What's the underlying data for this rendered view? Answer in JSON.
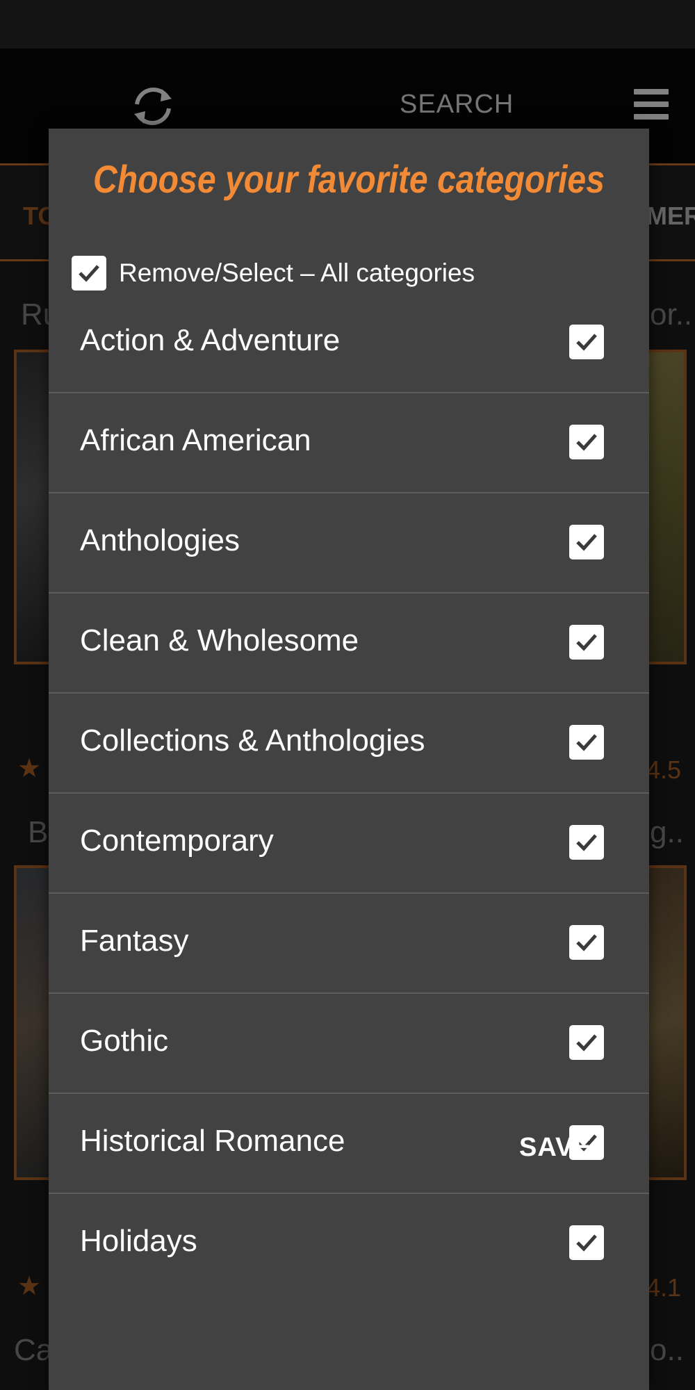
{
  "header": {
    "search_label": "SEARCH",
    "refresh_icon": "refresh-icon",
    "menu_icon": "hamburger-menu-icon"
  },
  "tabs": {
    "left_partial": "TO",
    "right_partial": "MER"
  },
  "background": {
    "items": [
      {
        "title_left": "Ru",
        "title_right": "or..",
        "rating": "4.5"
      },
      {
        "title_left": "B",
        "title_right": "g..",
        "rating": "4.1"
      },
      {
        "title_left": "Ca",
        "title_right": "o.."
      }
    ]
  },
  "dialog": {
    "title": "Choose your favorite categories",
    "select_all_label": "Remove/Select – All categories",
    "select_all_checked": true,
    "categories": [
      {
        "label": "Action & Adventure",
        "checked": true
      },
      {
        "label": "African American",
        "checked": true
      },
      {
        "label": "Anthologies",
        "checked": true
      },
      {
        "label": "Clean & Wholesome",
        "checked": true
      },
      {
        "label": "Collections & Anthologies",
        "checked": true
      },
      {
        "label": "Contemporary",
        "checked": true
      },
      {
        "label": "Fantasy",
        "checked": true
      },
      {
        "label": "Gothic",
        "checked": true
      },
      {
        "label": "Historical Romance",
        "checked": true
      },
      {
        "label": "Holidays",
        "checked": true
      }
    ],
    "save_label": "SAVE"
  },
  "colors": {
    "accent": "#f28a36",
    "dialog_bg": "#424242",
    "divider": "#5d5d5d"
  }
}
